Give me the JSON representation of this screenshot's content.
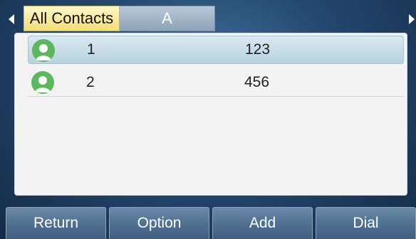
{
  "tabs": [
    {
      "label": "All Contacts",
      "active": true
    },
    {
      "label": "A",
      "active": false
    }
  ],
  "contacts": [
    {
      "name": "1",
      "number": "123",
      "selected": true,
      "icon": "contact-avatar-icon"
    },
    {
      "name": "2",
      "number": "456",
      "selected": false,
      "icon": "contact-avatar-icon"
    }
  ],
  "softkeys": [
    "Return",
    "Option",
    "Add",
    "Dial"
  ],
  "colors": {
    "active_tab": "#f4dd74",
    "inactive_tab": "#8ea3b8",
    "avatar": "#5cb85c",
    "selection": "#b7d2e0",
    "softkey": "#4f6f90"
  }
}
